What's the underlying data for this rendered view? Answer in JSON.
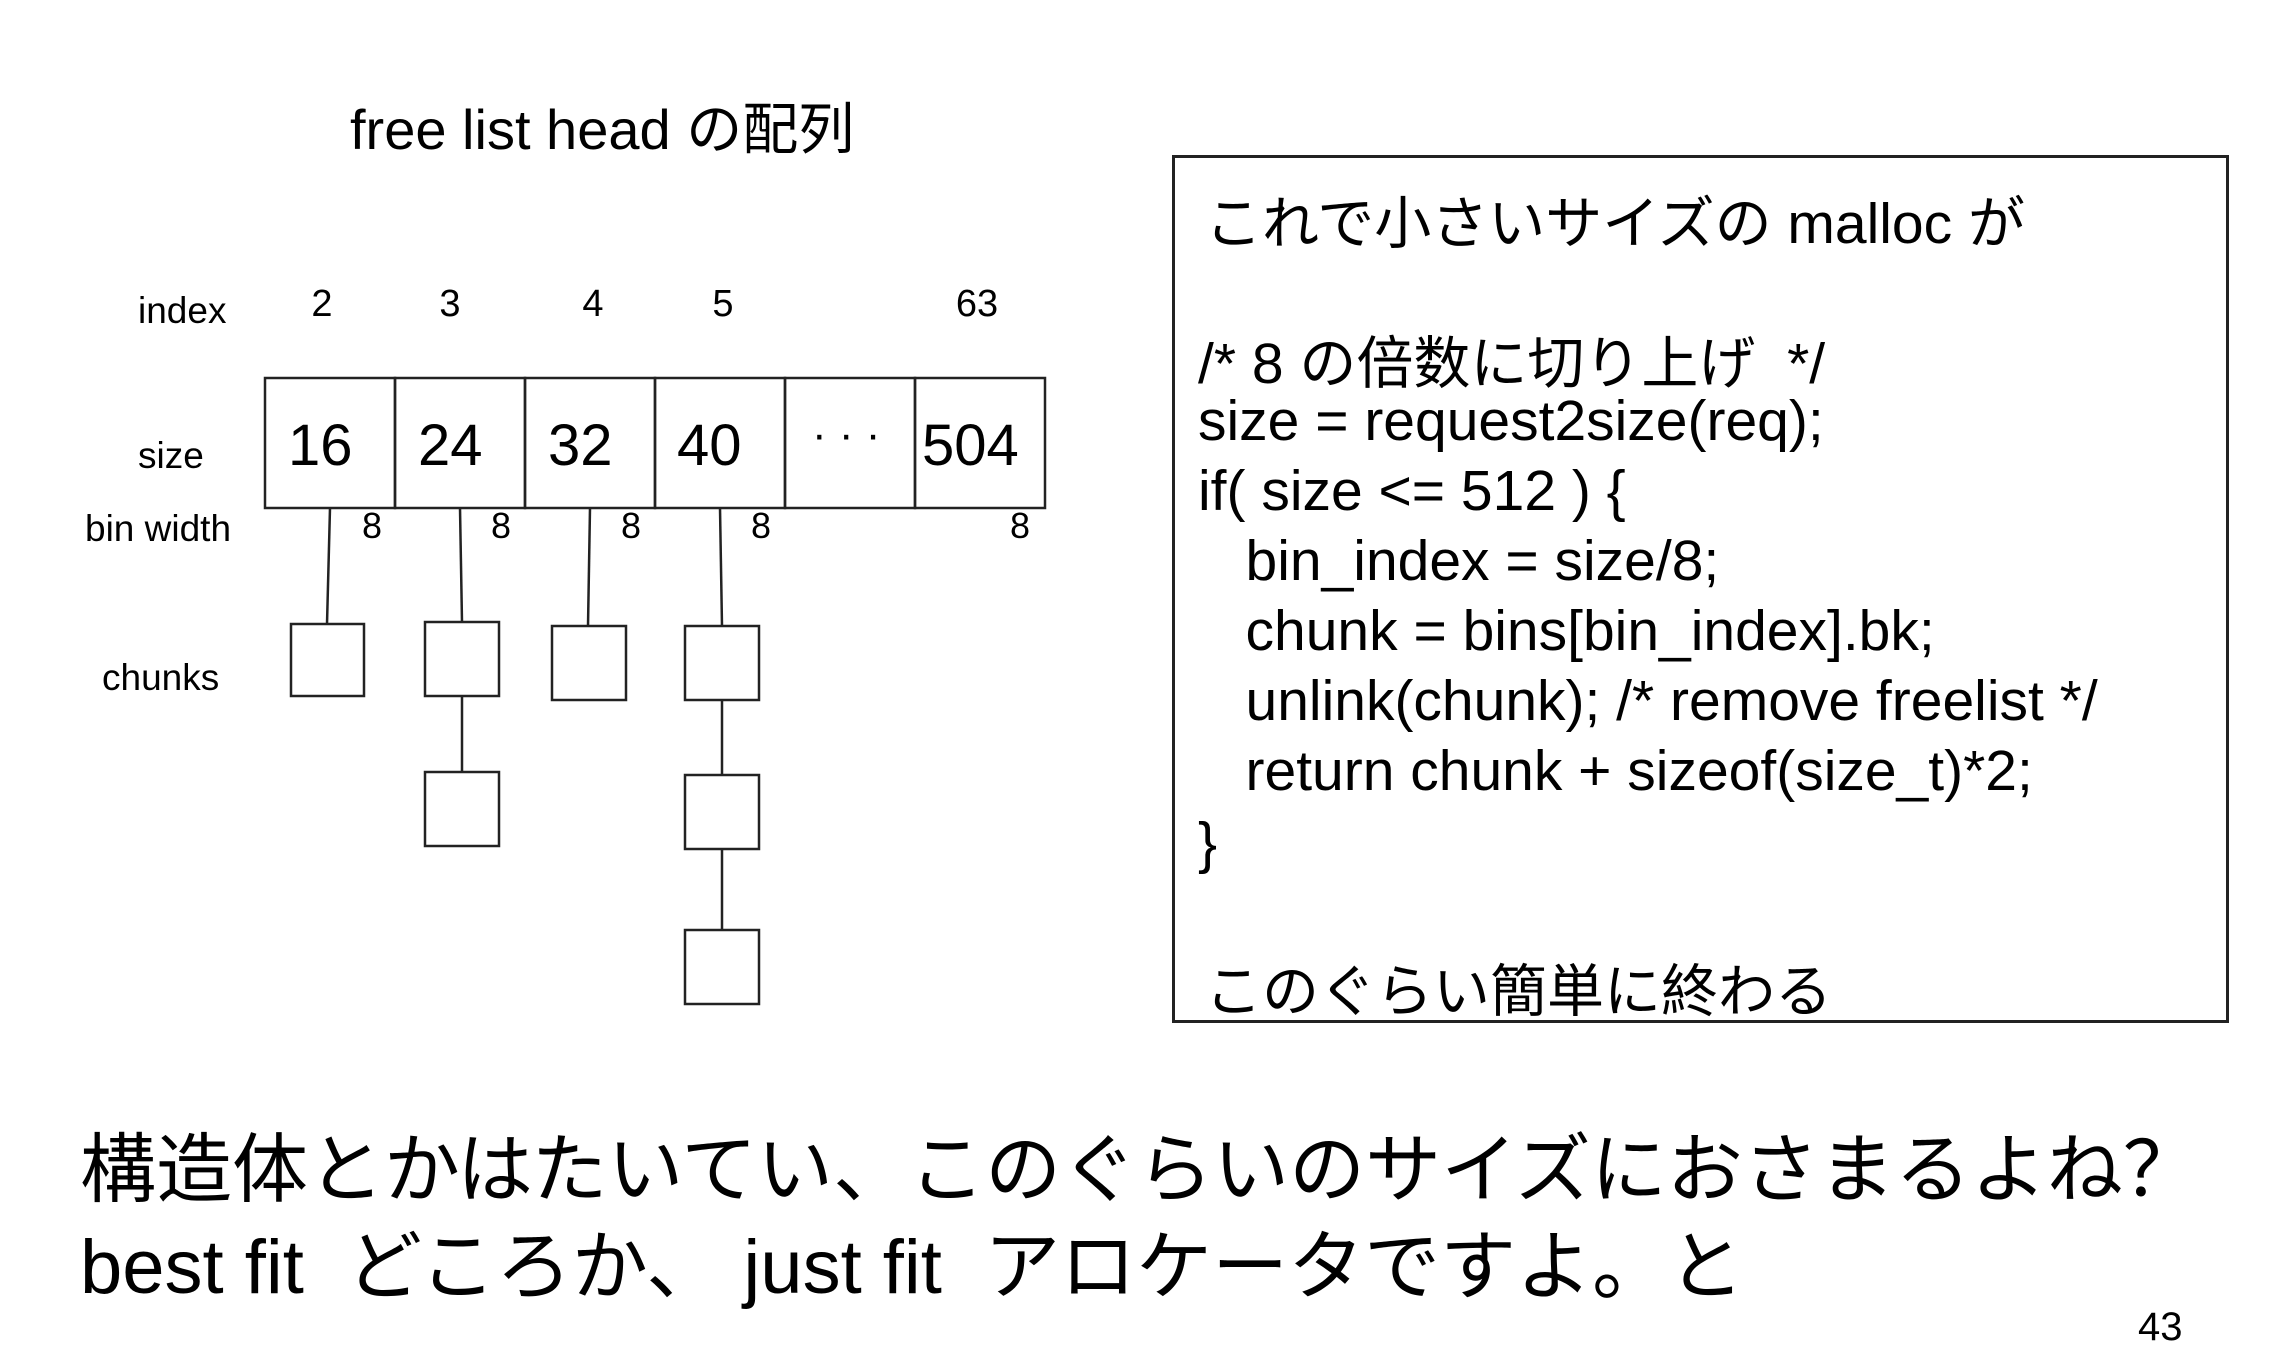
{
  "diagram": {
    "title": "free list head の配列",
    "labels": {
      "index": "index",
      "size": "size",
      "bin_width": "bin width",
      "chunks": "chunks"
    },
    "indices": [
      "2",
      "3",
      "4",
      "5",
      "63"
    ],
    "sizes": [
      "16",
      "24",
      "32",
      "40",
      "· · ·",
      "504"
    ],
    "bin_widths": [
      "8",
      "8",
      "8",
      "8",
      "8"
    ],
    "chunk_counts": [
      1,
      2,
      1,
      3
    ]
  },
  "code_box": {
    "lines": [
      "これで小さいサイズの malloc が",
      "",
      "/* 8 の倍数に切り上げ  */",
      "size = request2size(req);",
      "if( size <= 512 ) {",
      "   bin_index = size/8;",
      "   chunk = bins[bin_index].bk;",
      "   unlink(chunk); /* remove freelist */",
      "   return chunk + sizeof(size_t)*2;",
      "}",
      "",
      "このぐらい簡単に終わる"
    ]
  },
  "bottom_text": {
    "line1": "構造体とかはたいてい、このぐらいのサイズにおさまるよね？",
    "line2": "best fit  どころか、 just fit  アロケータですよ。と"
  },
  "page_number": "43"
}
